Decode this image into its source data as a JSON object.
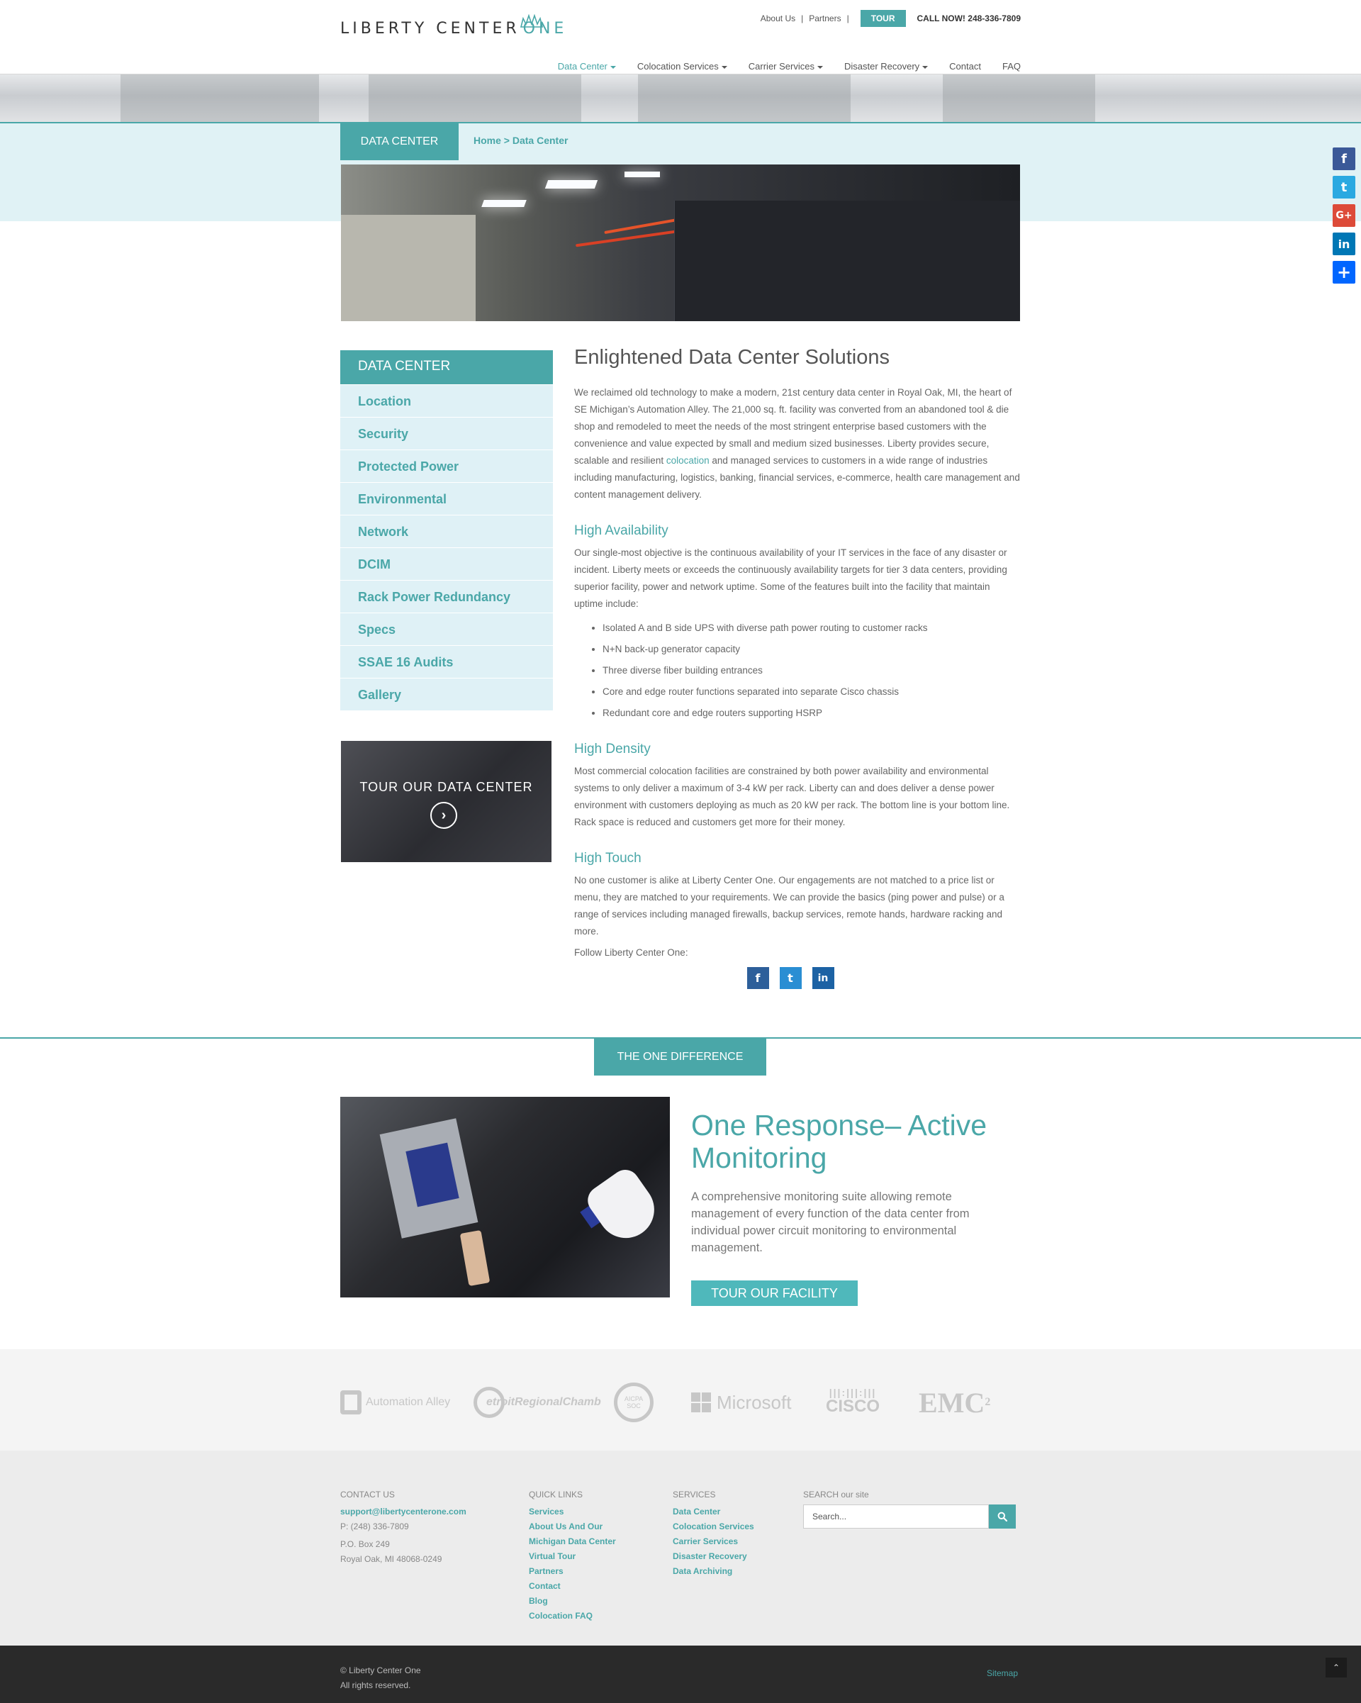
{
  "header": {
    "logo_main": "LIBERTY CENTER",
    "logo_accent": "ONE",
    "utility_links": [
      "About Us",
      "Partners"
    ],
    "tour_label": "TOUR",
    "call_now": "CALL NOW! 248-336-7809",
    "nav": [
      {
        "label": "Data Center",
        "dropdown": true,
        "active": true
      },
      {
        "label": "Colocation Services",
        "dropdown": true
      },
      {
        "label": "Carrier Services",
        "dropdown": true
      },
      {
        "label": "Disaster Recovery",
        "dropdown": true
      },
      {
        "label": "Contact"
      },
      {
        "label": "FAQ"
      }
    ]
  },
  "banner": {
    "tab": "DATA CENTER",
    "breadcrumb_home": "Home",
    "breadcrumb_sep": ">",
    "breadcrumb_current": "Data Center"
  },
  "side_social": [
    "facebook-icon",
    "twitter-icon",
    "google-plus-icon",
    "linkedin-icon",
    "share-icon"
  ],
  "sidebar": {
    "heading": "DATA CENTER",
    "items": [
      "Location",
      "Security",
      "Protected Power",
      "Environmental",
      "Network",
      "DCIM",
      "Rack Power Redundancy",
      "Specs",
      "SSAE 16 Audits",
      "Gallery"
    ],
    "tour_box": "TOUR OUR DATA CENTER"
  },
  "content": {
    "title": "Enlightened Data Center Solutions",
    "intro_before_link": "We reclaimed old technology to make a modern, 21st century data center in Royal Oak, MI, the heart of SE Michigan’s Automation Alley. The 21,000 sq. ft. facility was converted from an abandoned tool & die shop and remodeled to meet the needs of the most stringent enterprise based customers with the convenience and value expected by small and medium sized businesses. Liberty provides secure, scalable and resilient ",
    "intro_link": "colocation",
    "intro_after_link": " and managed services to customers in a wide range of industries including manufacturing, logistics, banking, financial services, e-commerce, health care management and content management delivery.",
    "ha_title": "High Availability",
    "ha_text": "Our single-most objective is the continuous availability of your IT services in the face of any disaster or incident. Liberty meets or exceeds the continuously availability targets for tier 3 data centers, providing superior facility, power and network uptime. Some of the features built into the facility that maintain uptime include:",
    "ha_list": [
      "Isolated A and B side UPS with diverse path power routing to customer racks",
      "N+N back-up generator capacity",
      "Three diverse fiber building entrances",
      "Core and edge router functions separated into separate Cisco chassis",
      "Redundant core and edge routers supporting HSRP"
    ],
    "hd_title": "High Density",
    "hd_text": "Most commercial colocation facilities are constrained by both power availability and environmental systems to only deliver a maximum of 3-4 kW per rack. Liberty can and does deliver a dense power environment with customers deploying as much as 20 kW per rack. The bottom line is your bottom line. Rack space is reduced and customers get more for their money.",
    "ht_title": "High Touch",
    "ht_text": "No one customer is alike at Liberty Center One. Our engagements are not matched to a price list or menu, they are matched to your requirements. We can provide the basics (ping power and pulse) or a range of services including managed firewalls, backup services, remote hands, hardware racking and more.",
    "follow": "Follow Liberty Center One:"
  },
  "difference": {
    "tab": "THE ONE DIFFERENCE",
    "title": "One Response– Active Monitoring",
    "text": "A comprehensive monitoring suite allowing remote management of every function of the data center from individual power circuit monitoring to environmental management.",
    "button": "TOUR OUR FACILITY"
  },
  "partners": [
    "Automation Alley",
    "etroitRegionalChamb",
    "AICPA SOC",
    "Microsoft",
    "CISCO",
    "EMC"
  ],
  "footer": {
    "contact_heading": "CONTACT US",
    "email": "support@libertycenterone.com",
    "phone": "P: (248) 336-7809",
    "po_box": "P.O. Box 249",
    "city": "Royal Oak, MI 48068-0249",
    "quick_heading": "QUICK LINKS",
    "quick_links": [
      "Services",
      "About Us And Our",
      "Michigan Data Center",
      "Virtual Tour",
      "Partners",
      "Contact",
      "Blog",
      "Colocation FAQ"
    ],
    "services_heading": "SERVICES",
    "services": [
      "Data Center",
      "Colocation Services",
      "Carrier Services",
      "Disaster Recovery",
      "Data Archiving"
    ],
    "search_heading": "SEARCH our site",
    "search_placeholder": "Search...",
    "copyright": "© Liberty Center One",
    "rights": "All rights reserved.",
    "sitemap": "Sitemap"
  },
  "colors": {
    "accent": "#4aa7a8",
    "light_band": "#e0f2f5",
    "sidebar_item": "#dff1f6",
    "footer_bg": "#ececec",
    "bottom_bar": "#2a2a2a"
  }
}
